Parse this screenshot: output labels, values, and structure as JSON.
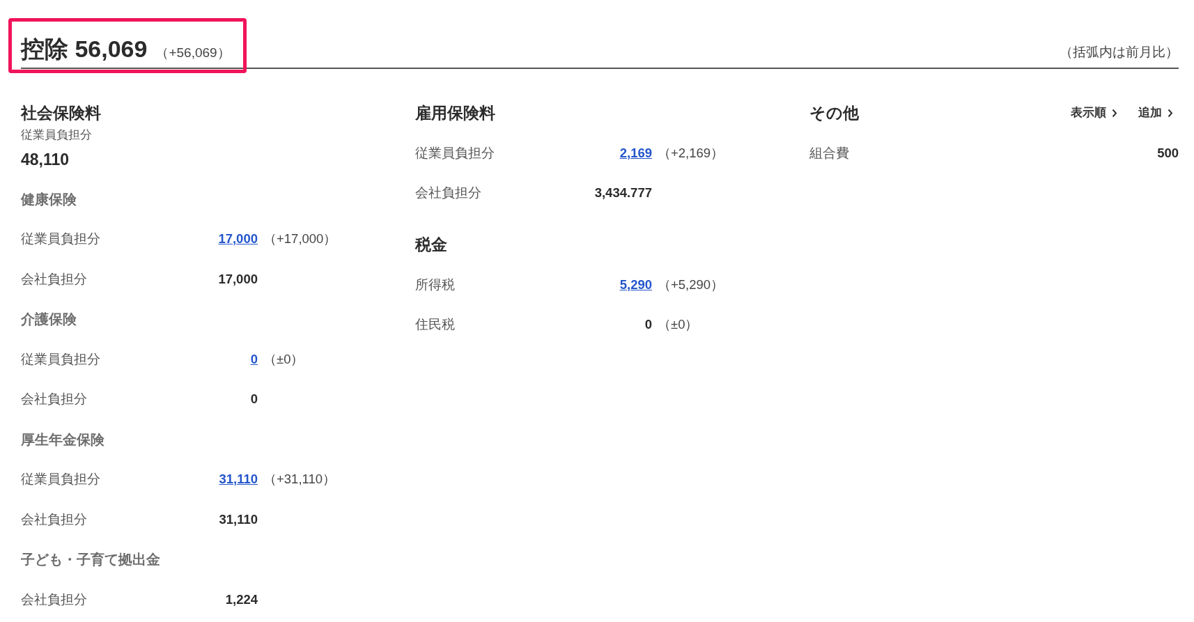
{
  "header": {
    "title": "控除",
    "total": "56,069",
    "diff": "（+56,069）",
    "highlighted": true,
    "note": "（括弧内は前月比）"
  },
  "columns": [
    {
      "blocks": [
        {
          "kind": "heading",
          "text": "社会保険料"
        },
        {
          "kind": "caption",
          "text": "従業員負担分"
        },
        {
          "kind": "total",
          "text": "48,110"
        },
        {
          "kind": "subheading",
          "text": "健康保険"
        },
        {
          "kind": "row",
          "label": "従業員負担分",
          "value": "17,000",
          "link": true,
          "diff": "（+17,000）"
        },
        {
          "kind": "row",
          "label": "会社負担分",
          "value": "17,000",
          "link": false
        },
        {
          "kind": "subheading",
          "text": "介護保険"
        },
        {
          "kind": "row",
          "label": "従業員負担分",
          "value": "0",
          "link": true,
          "diff": "（±0）"
        },
        {
          "kind": "row",
          "label": "会社負担分",
          "value": "0",
          "link": false
        },
        {
          "kind": "subheading",
          "text": "厚生年金保険"
        },
        {
          "kind": "row",
          "label": "従業員負担分",
          "value": "31,110",
          "link": true,
          "diff": "（+31,110）"
        },
        {
          "kind": "row",
          "label": "会社負担分",
          "value": "31,110",
          "link": false
        },
        {
          "kind": "subheading",
          "text": "子ども・子育て拠出金"
        },
        {
          "kind": "row",
          "label": "会社負担分",
          "value": "1,224",
          "link": false
        }
      ]
    },
    {
      "blocks": [
        {
          "kind": "heading",
          "text": "雇用保険料"
        },
        {
          "kind": "row",
          "label": "従業員負担分",
          "value": "2,169",
          "link": true,
          "diff": "（+2,169）"
        },
        {
          "kind": "row",
          "label": "会社負担分",
          "value": "3,434.777",
          "link": false
        },
        {
          "kind": "heading",
          "text": "税金"
        },
        {
          "kind": "row",
          "label": "所得税",
          "value": "5,290",
          "link": true,
          "diff": "（+5,290）"
        },
        {
          "kind": "row",
          "label": "住民税",
          "value": "0",
          "link": false,
          "diff": "（±0）"
        }
      ]
    },
    {
      "blocks": [
        {
          "kind": "heading",
          "text": "その他",
          "actions": [
            "表示順",
            "追加"
          ]
        },
        {
          "kind": "end_row",
          "label": "組合費",
          "value": "500"
        }
      ]
    }
  ]
}
